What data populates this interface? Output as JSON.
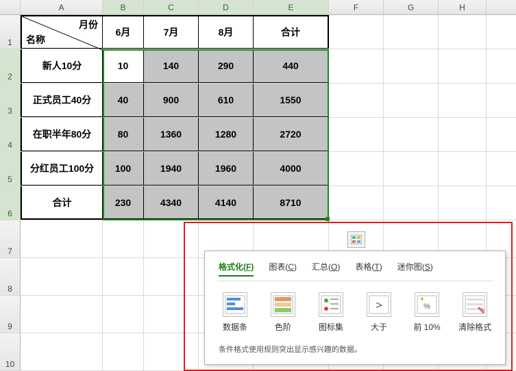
{
  "columns": [
    "A",
    "B",
    "C",
    "D",
    "E",
    "F",
    "G",
    "H"
  ],
  "rows": [
    "1",
    "2",
    "3",
    "4",
    "5",
    "6",
    "7",
    "8",
    "9",
    "10"
  ],
  "header": {
    "diag_top": "月份",
    "diag_bottom": "名称",
    "months": [
      "6月",
      "7月",
      "8月"
    ],
    "total_label": "合计"
  },
  "body_rows": [
    {
      "name": "新人10分",
      "vals": [
        "10",
        "140",
        "290"
      ],
      "sum": "440"
    },
    {
      "name": "正式员工40分",
      "vals": [
        "40",
        "900",
        "610"
      ],
      "sum": "1550"
    },
    {
      "name": "在职半年80分",
      "vals": [
        "80",
        "1360",
        "1280"
      ],
      "sum": "2720"
    },
    {
      "name": "分红员工100分",
      "vals": [
        "100",
        "1940",
        "1960"
      ],
      "sum": "4000"
    }
  ],
  "footer": {
    "label": "合计",
    "vals": [
      "230",
      "4340",
      "4140"
    ],
    "sum": "8710"
  },
  "chart_data": {
    "type": "table",
    "columns": [
      "名称",
      "6月",
      "7月",
      "8月",
      "合计"
    ],
    "rows": [
      [
        "新人10分",
        10,
        140,
        290,
        440
      ],
      [
        "正式员工40分",
        40,
        900,
        610,
        1550
      ],
      [
        "在职半年80分",
        80,
        1360,
        1280,
        2720
      ],
      [
        "分红员工100分",
        100,
        1940,
        1960,
        4000
      ],
      [
        "合计",
        230,
        4340,
        4140,
        8710
      ]
    ]
  },
  "quick_analysis": {
    "button_icon": "quick-analysis-icon",
    "tabs": [
      {
        "label": "格式化",
        "accel": "F",
        "active": true
      },
      {
        "label": "图表",
        "accel": "C"
      },
      {
        "label": "汇总",
        "accel": "O"
      },
      {
        "label": "表格",
        "accel": "T"
      },
      {
        "label": "迷你图",
        "accel": "S"
      }
    ],
    "options": [
      "数据条",
      "色阶",
      "图标集",
      "大于",
      "前 10%",
      "清除格式"
    ],
    "description": "条件格式使用规则突出显示感兴趣的数据。"
  }
}
